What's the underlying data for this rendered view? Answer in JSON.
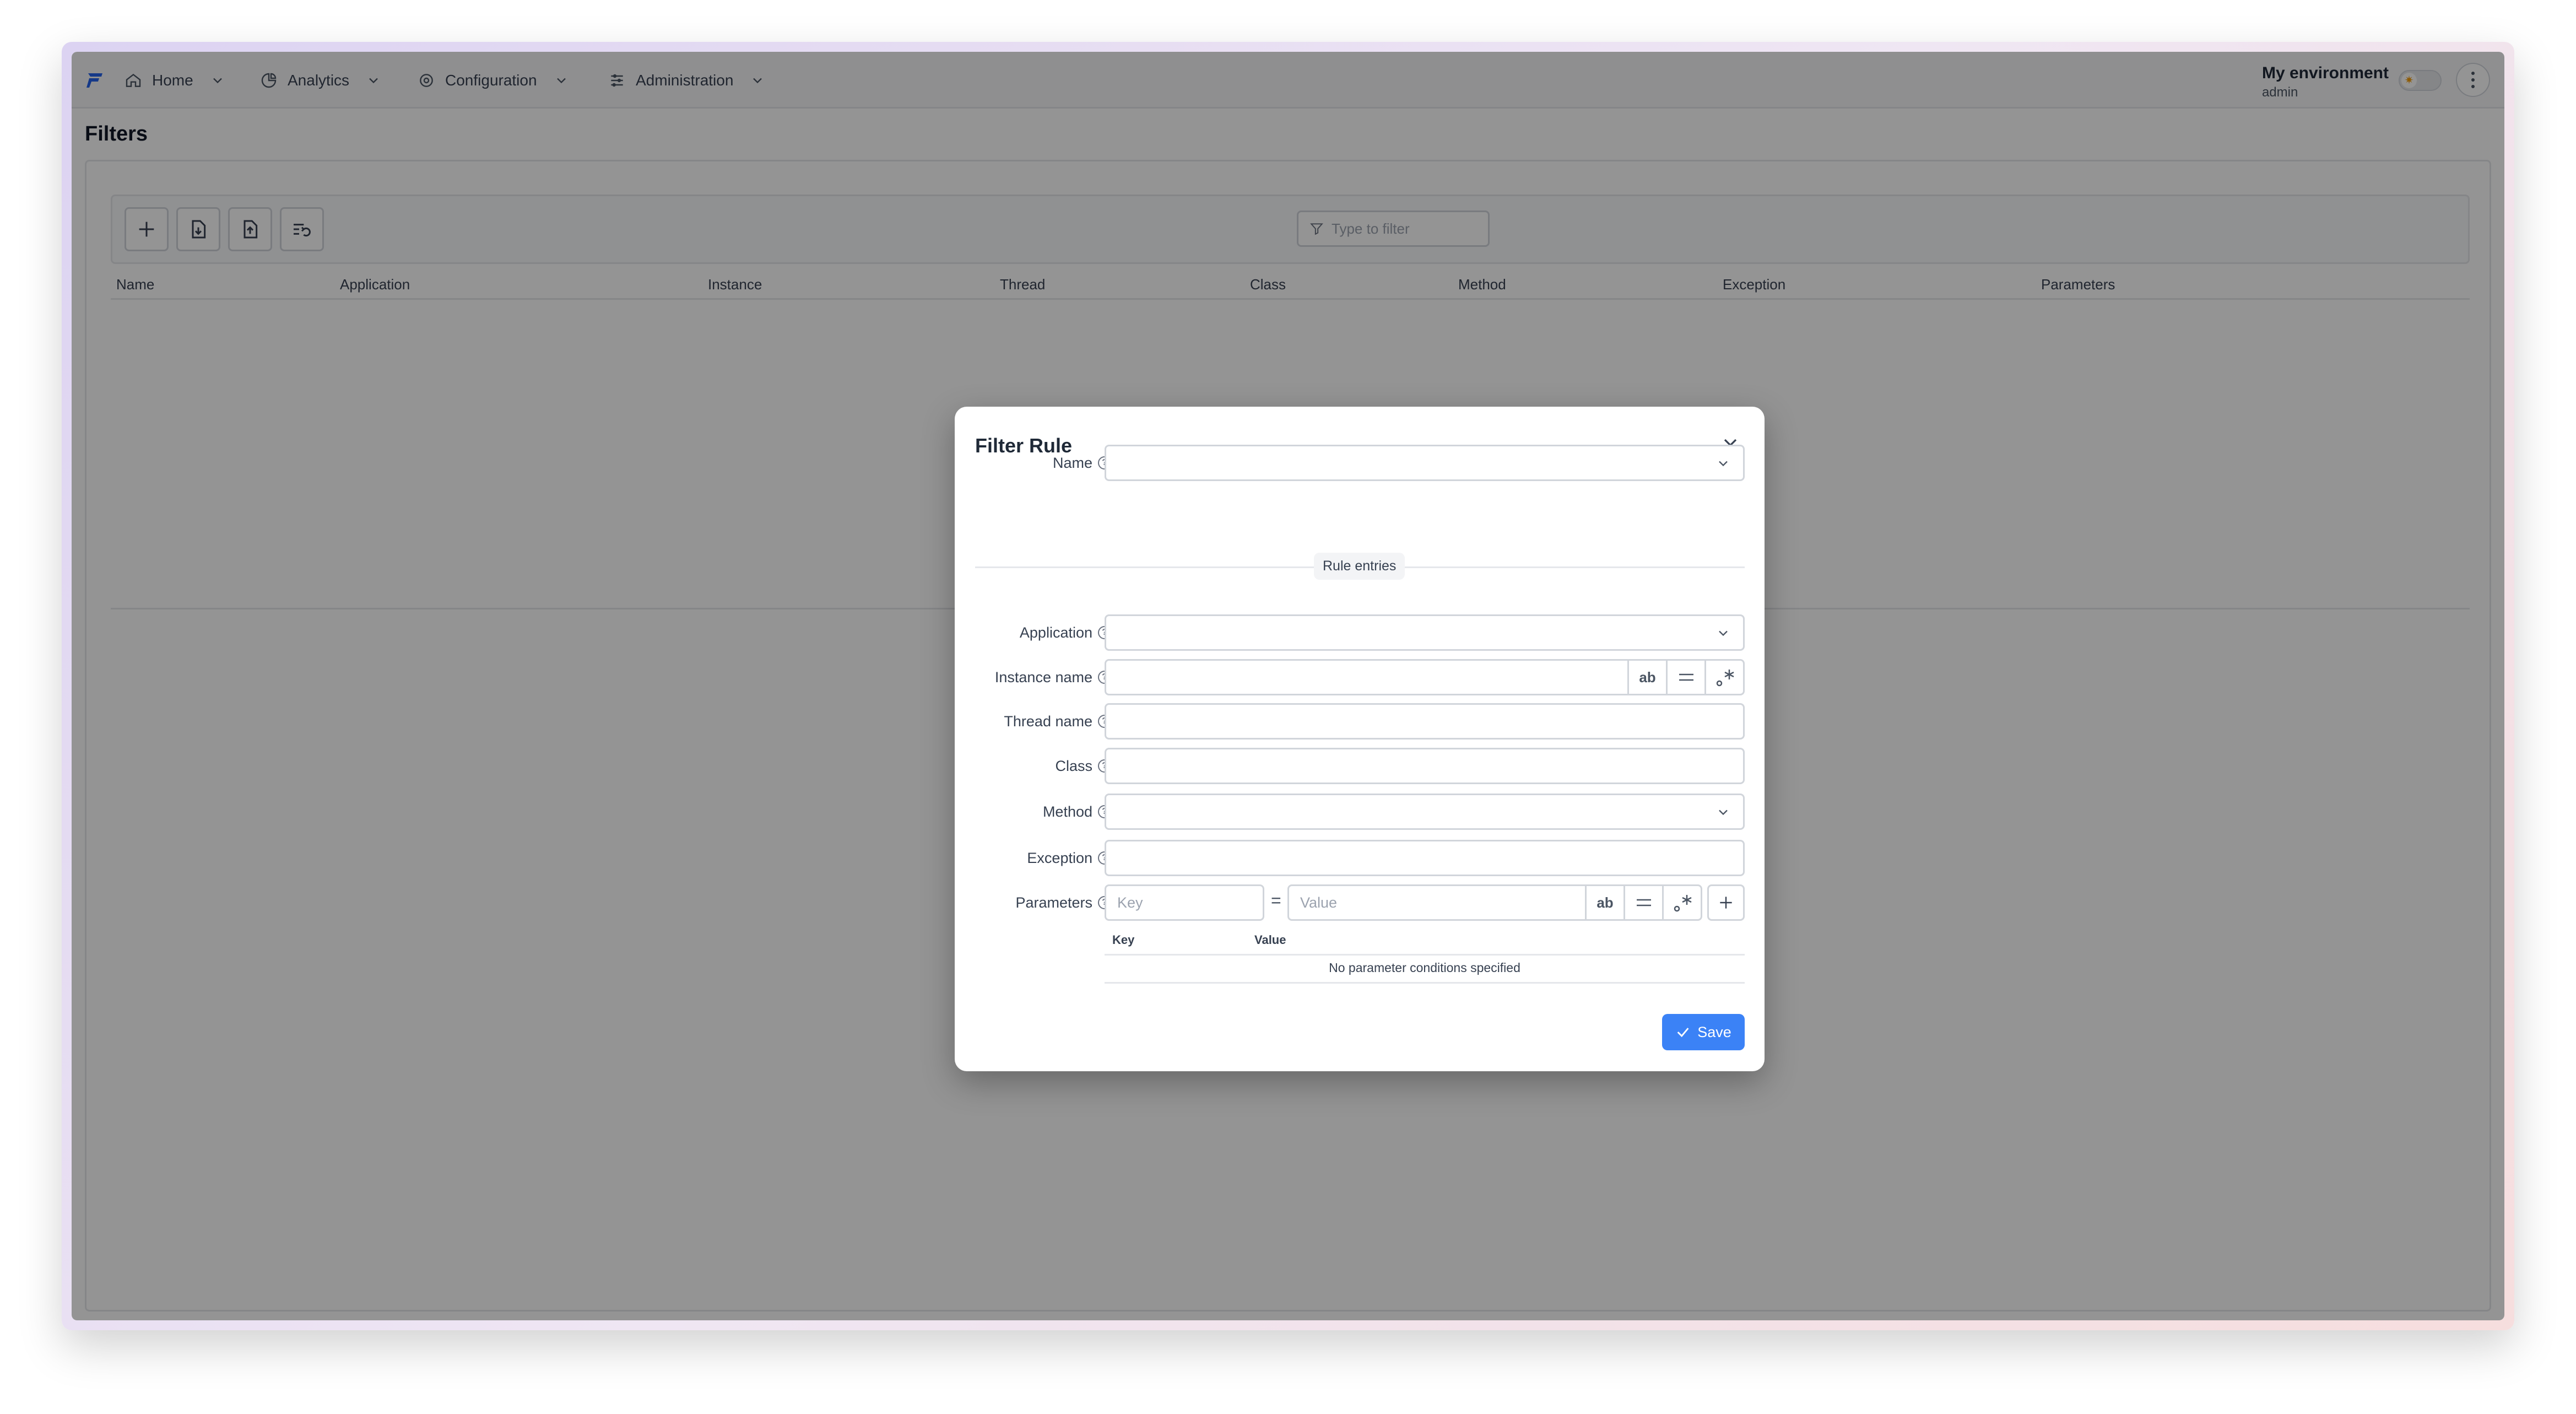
{
  "colors": {
    "accent": "#3b82f6",
    "logo": "#2563eb",
    "border": "#d1d5db",
    "overlay": "rgba(0,0,0,0.42)"
  },
  "nav": {
    "items": [
      {
        "label": "Home",
        "icon": "home-icon"
      },
      {
        "label": "Analytics",
        "icon": "analytics-icon"
      },
      {
        "label": "Configuration",
        "icon": "gear-icon"
      },
      {
        "label": "Administration",
        "icon": "sliders-icon"
      }
    ],
    "environment": {
      "name": "My environment",
      "user": "admin"
    }
  },
  "page": {
    "title": "Filters",
    "filter_placeholder": "Type to filter",
    "columns": [
      "Name",
      "Application",
      "Instance",
      "Thread",
      "Class",
      "Method",
      "Exception",
      "Parameters"
    ]
  },
  "modal": {
    "title": "Filter Rule",
    "name_label": "Name",
    "section_label": "Rule entries",
    "application_label": "Application",
    "instance_label": "Instance name",
    "thread_label": "Thread name",
    "class_label": "Class",
    "method_label": "Method",
    "exception_label": "Exception",
    "parameters_label": "Parameters",
    "mode_buttons": {
      "case": "ab",
      "equals": "=",
      "regex": ".*"
    },
    "param_key_placeholder": "Key",
    "param_value_placeholder": "Value",
    "param_eq": "=",
    "param_table": {
      "key_header": "Key",
      "value_header": "Value",
      "empty_text": "No parameter conditions specified"
    },
    "save_label": "Save"
  }
}
